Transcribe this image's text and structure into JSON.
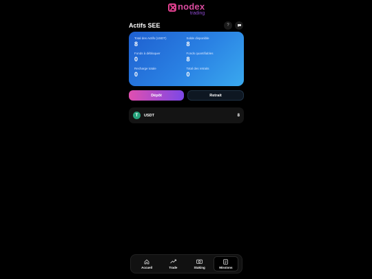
{
  "brand": {
    "name": "nodex",
    "sub": "trading"
  },
  "header": {
    "title": "Actifs SEE",
    "help_icon": "?",
    "chat_icon": "chat-bubble-icon"
  },
  "stats": [
    {
      "label": "Total des Actifs (USDT)",
      "value": "8"
    },
    {
      "label": "Solde disponible",
      "value": "8"
    },
    {
      "label": "Fonds à débloquer",
      "value": "0"
    },
    {
      "label": "Fonds quantifiables",
      "value": "8"
    },
    {
      "label": "Recharge totale",
      "value": "0"
    },
    {
      "label": "Total des retraits",
      "value": "0"
    }
  ],
  "actions": {
    "deposit": "Dépôt",
    "withdraw": "Retrait"
  },
  "assets": [
    {
      "symbol": "T",
      "name": "USDT",
      "value": "8"
    }
  ],
  "nav": [
    {
      "label": "Accueil",
      "icon": "home-icon"
    },
    {
      "label": "Trade",
      "icon": "trend-icon"
    },
    {
      "label": "Staking",
      "icon": "camera-icon"
    },
    {
      "label": "Missions",
      "icon": "clipboard-icon",
      "active": true
    }
  ],
  "colors": {
    "accent_pink": "#e04fb0",
    "accent_purple": "#7c48e6",
    "card_blue": "#2a82e4",
    "usdt_green": "#26a17b"
  }
}
